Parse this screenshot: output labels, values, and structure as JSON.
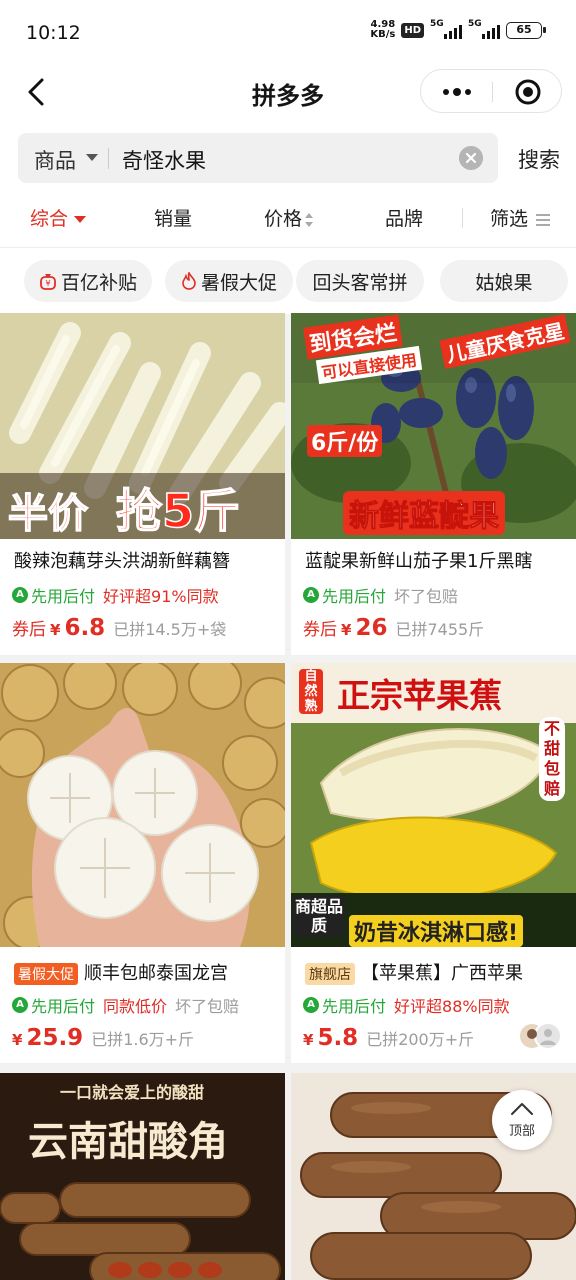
{
  "status": {
    "time": "10:12",
    "speed_top": "4.98",
    "speed_bottom": "KB/s",
    "hd": "HD",
    "net1": "5G",
    "net2": "5G",
    "battery": "65"
  },
  "nav": {
    "title": "拼多多"
  },
  "search": {
    "category": "商品",
    "query": "奇怪水果",
    "button": "搜索"
  },
  "sort": {
    "items": [
      "综合",
      "销量",
      "价格",
      "品牌",
      "筛选"
    ]
  },
  "tags": [
    "百亿补贴",
    "暑假大促",
    "回头客常拼",
    "姑娘果"
  ],
  "products": [
    {
      "name": "酸辣泡藕芽头洪湖新鲜藕簪",
      "pay": "先用后付",
      "tag": "好评超91%同款",
      "coupon": "券后",
      "yen": "¥",
      "price": "6.8",
      "sold": "已拼14.5万+袋",
      "img_text1": "半价",
      "img_text2": "抢5斤"
    },
    {
      "name": "蓝靛果新鲜山茄子果1斤黑瞎",
      "pay": "先用后付",
      "tag": "坏了包赔",
      "coupon": "券后",
      "yen": "¥",
      "price": "26",
      "sold": "已拼7455斤",
      "img_text1": "到货会烂",
      "img_text2": "可以直接使用",
      "img_text3": "儿童厌食克星",
      "img_text4": "6斤/份",
      "img_text5": "新鲜蓝靛果"
    },
    {
      "badge": "暑假大促",
      "name": "顺丰包邮泰国龙宫",
      "pay": "先用后付",
      "tag": "同款低价",
      "tag2": "坏了包赔",
      "yen": "¥",
      "price": "25.9",
      "sold": "已拼1.6万+斤"
    },
    {
      "badge": "旗舰店",
      "name": "【苹果蕉】广西苹果",
      "pay": "先用后付",
      "tag": "好评超88%同款",
      "yen": "¥",
      "price": "5.8",
      "sold": "已拼200万+斤",
      "img_text1": "正宗苹果蕉",
      "img_text2": "自然熟",
      "img_text3": "不甜包赔",
      "img_text4": "商超品质",
      "img_text5": "奶昔冰淇淋口感!"
    },
    {
      "img_text1": "一口就会爱上的酸甜",
      "img_text2": "云南甜酸角"
    },
    {}
  ],
  "top_button": "顶部",
  "colors": {
    "accent": "#e02e24",
    "green": "#25a839"
  }
}
